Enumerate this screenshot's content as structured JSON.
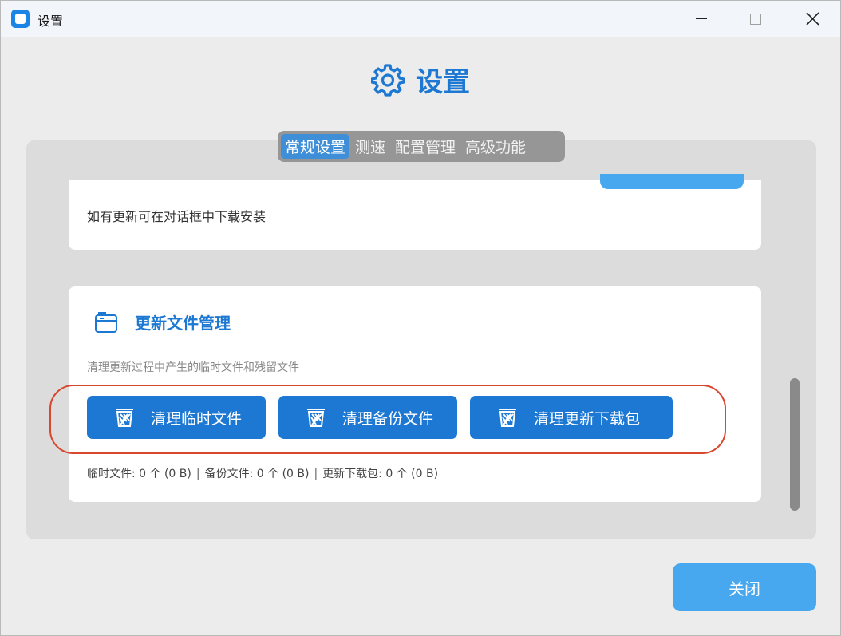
{
  "window": {
    "title": "设置"
  },
  "header": {
    "title": "设置",
    "icon": "gear-icon",
    "accent": "#1c78d2"
  },
  "tabs": [
    {
      "label": "常规设置",
      "active": true
    },
    {
      "label": "测速",
      "active": false
    },
    {
      "label": "配置管理",
      "active": false
    },
    {
      "label": "高级功能",
      "active": false
    }
  ],
  "update_card": {
    "description": "如有更新可在对话框中下载安装"
  },
  "file_management": {
    "title": "更新文件管理",
    "description": "清理更新过程中产生的临时文件和残留文件",
    "buttons": [
      {
        "label": "清理临时文件",
        "icon": "trash-icon"
      },
      {
        "label": "清理备份文件",
        "icon": "trash-icon"
      },
      {
        "label": "清理更新下载包",
        "icon": "trash-icon"
      }
    ],
    "stats": {
      "temp": "临时文件: 0 个 (0 B)",
      "backup": "备份文件: 0 个 (0 B)",
      "package": "更新下载包: 0 个 (0 B)",
      "separator": "|"
    }
  },
  "footer": {
    "close_label": "关闭"
  },
  "colors": {
    "primary": "#1c78d2",
    "light_button": "#47a8f0",
    "highlight_border": "#d9472f"
  }
}
